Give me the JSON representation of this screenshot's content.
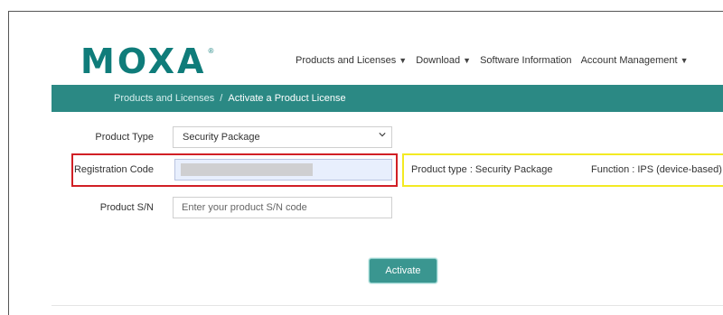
{
  "colors": {
    "brand": "#0f7c7a",
    "bar": "#2b8984",
    "button": "#3a9690",
    "highlight_red": "#d11f25",
    "highlight_yellow": "#f3ea23"
  },
  "header": {
    "logo_text": "MOXA",
    "logo_mark": "®",
    "nav": [
      {
        "label": "Products and Licenses",
        "dropdown": true
      },
      {
        "label": "Download",
        "dropdown": true
      },
      {
        "label": "Software Information",
        "dropdown": false
      },
      {
        "label": "Account Management",
        "dropdown": true
      }
    ]
  },
  "breadcrumb": {
    "parent": "Products and Licenses",
    "separator": "/",
    "current": "Activate a Product License"
  },
  "form": {
    "product_type": {
      "label": "Product Type",
      "value": "Security Package",
      "icon": "chevron-down-icon"
    },
    "registration_code": {
      "label": "Registration Code"
    },
    "product_sn": {
      "label": "Product S/N",
      "placeholder": "Enter your product S/N code"
    },
    "info": {
      "product_type_text": "Product type : Security Package",
      "function_text": "Function : IPS (device-based)"
    },
    "activate_label": "Activate"
  }
}
